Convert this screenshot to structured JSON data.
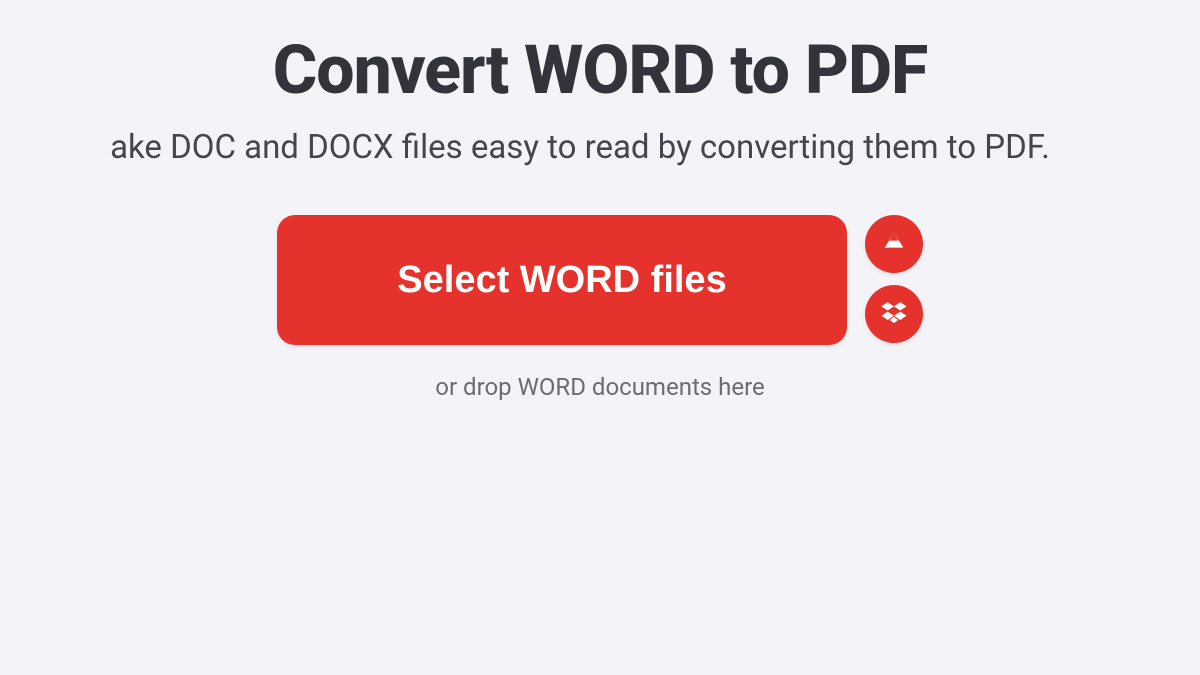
{
  "header": {
    "title": "Convert WORD to PDF",
    "subtitle": "ake DOC and DOCX files easy to read by converting them to PDF."
  },
  "upload": {
    "select_label": "Select WORD files",
    "drop_hint": "or drop WORD documents here"
  },
  "cloud": {
    "drive_name": "google-drive-icon",
    "dropbox_name": "dropbox-icon"
  },
  "colors": {
    "accent": "#e5322d",
    "bg": "#f4f4f8",
    "text_dark": "#33333b",
    "text_muted": "#6b6b74"
  }
}
